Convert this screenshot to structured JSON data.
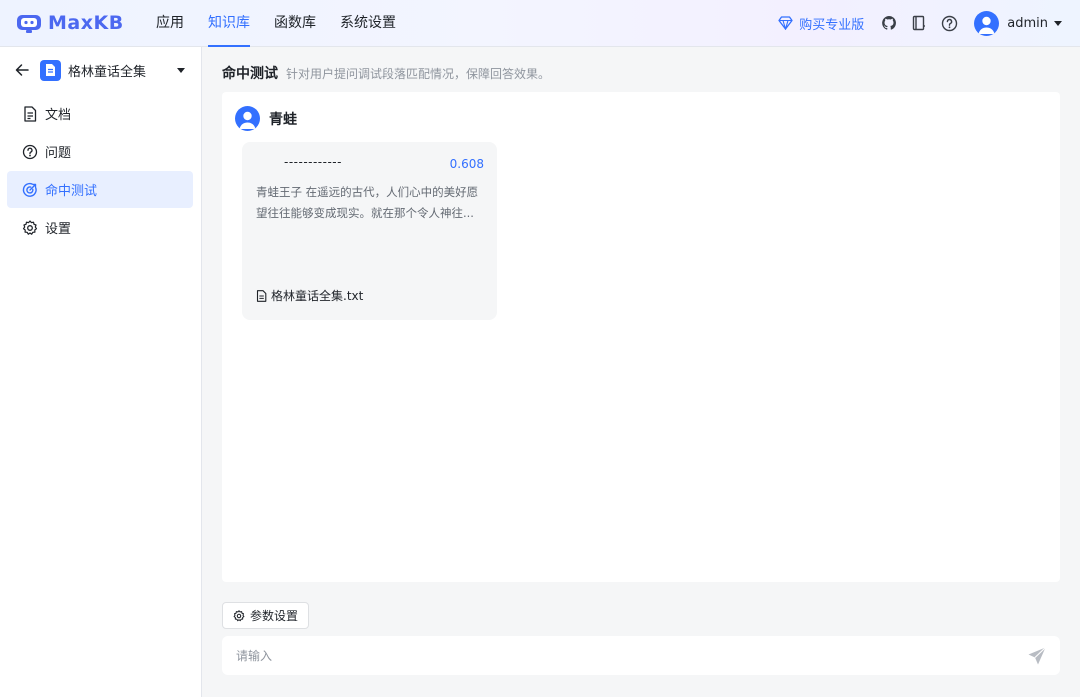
{
  "app": {
    "name": "MaxKB"
  },
  "nav": [
    {
      "label": "应用",
      "active": false
    },
    {
      "label": "知识库",
      "active": true
    },
    {
      "label": "函数库",
      "active": false
    },
    {
      "label": "系统设置",
      "active": false
    }
  ],
  "header": {
    "pro_label": "购买专业版",
    "user_name": "admin",
    "icons": [
      "diamond-icon",
      "github-icon",
      "book-icon",
      "help-icon"
    ]
  },
  "sidebar": {
    "kb_name": "格林童话全集",
    "items": [
      {
        "label": "文档",
        "icon": "document-icon",
        "active": false
      },
      {
        "label": "问题",
        "icon": "question-icon",
        "active": false
      },
      {
        "label": "命中测试",
        "icon": "target-icon",
        "active": true
      },
      {
        "label": "设置",
        "icon": "gear-icon",
        "active": false
      }
    ]
  },
  "main": {
    "title": "命中测试",
    "description": "针对用户提问调试段落匹配情况，保障回答效果。",
    "query": "青蛙",
    "results": [
      {
        "title": "------------",
        "score": "0.608",
        "content": "青蛙王子 在遥远的古代，人们心中的美好愿望往往能够变成现实。就在那个令人神往...",
        "file": "格林童话全集.txt"
      }
    ],
    "params_label": "参数设置",
    "input_placeholder": "请输入"
  },
  "colors": {
    "accent": "#3370ff",
    "text": "#1f2329",
    "muted": "#8f959e"
  }
}
